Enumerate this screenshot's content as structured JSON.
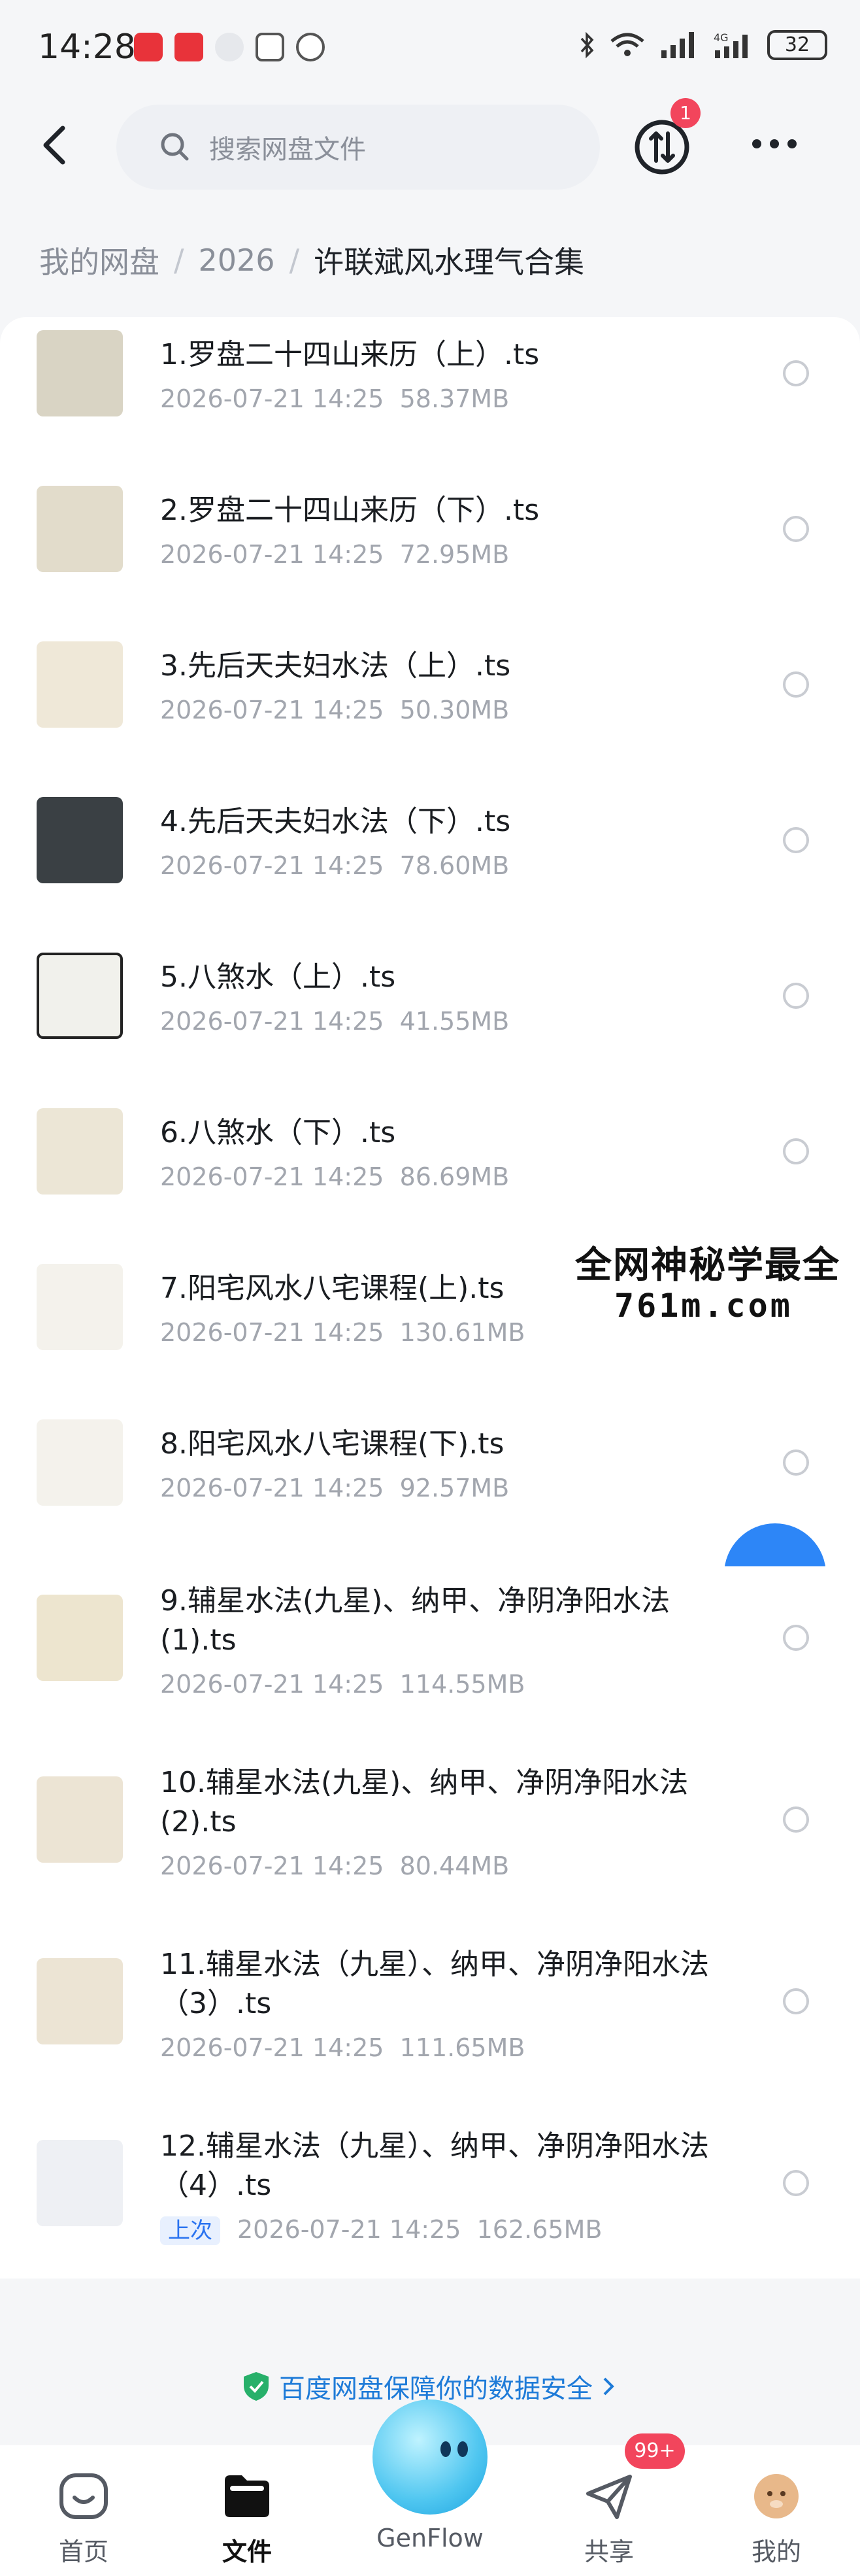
{
  "status_bar": {
    "time": "14:28",
    "battery": "32"
  },
  "header": {
    "search_placeholder": "搜索网盘文件",
    "sync_badge": "1"
  },
  "breadcrumb": {
    "items": [
      "我的网盘",
      "2026",
      "许联斌风水理气合集"
    ],
    "separator": "/"
  },
  "files": [
    {
      "name": "1.罗盘二十四山来历（上）.ts",
      "date": "2026-07-21  14:25",
      "size": "58.37MB"
    },
    {
      "name": "2.罗盘二十四山来历（下）.ts",
      "date": "2026-07-21  14:25",
      "size": "72.95MB"
    },
    {
      "name": "3.先后天夫妇水法（上）.ts",
      "date": "2026-07-21  14:25",
      "size": "50.30MB"
    },
    {
      "name": "4.先后天夫妇水法（下）.ts",
      "date": "2026-07-21  14:25",
      "size": "78.60MB"
    },
    {
      "name": "5.八煞水（上）.ts",
      "date": "2026-07-21  14:25",
      "size": "41.55MB"
    },
    {
      "name": "6.八煞水（下）.ts",
      "date": "2026-07-21  14:25",
      "size": "86.69MB"
    },
    {
      "name": "7.阳宅风水八宅课程(上).ts",
      "date": "2026-07-21  14:25",
      "size": "130.61MB"
    },
    {
      "name": "8.阳宅风水八宅课程(下).ts",
      "date": "2026-07-21  14:25",
      "size": "92.57MB"
    },
    {
      "name": "9.辅星水法(九星)、纳甲、净阴净阳水法(1).ts",
      "date": "2026-07-21  14:25",
      "size": "114.55MB"
    },
    {
      "name": "10.辅星水法(九星)、纳甲、净阴净阳水法(2).ts",
      "date": "2026-07-21  14:25",
      "size": "80.44MB"
    },
    {
      "name": "11.辅星水法（九星）、纳甲、净阴净阳水法（3）.ts",
      "date": "2026-07-21  14:25",
      "size": "111.65MB"
    },
    {
      "name": "12.辅星水法（九星）、纳甲、净阴净阳水法（4）.ts",
      "date": "2026-07-21  14:25",
      "size": "162.65MB",
      "tag": "上次"
    }
  ],
  "watermark": {
    "line1": "全网神秘学最全",
    "line2": "761m.com"
  },
  "security_banner": "百度网盘保障你的数据安全",
  "tabbar": {
    "home": "首页",
    "files": "文件",
    "genflow": "GenFlow",
    "share": "共享",
    "share_badge": "99+",
    "mine": "我的"
  },
  "colors": {
    "accent": "#2a73f0",
    "badge": "#f2455c",
    "security_text": "#1e7bd8"
  }
}
